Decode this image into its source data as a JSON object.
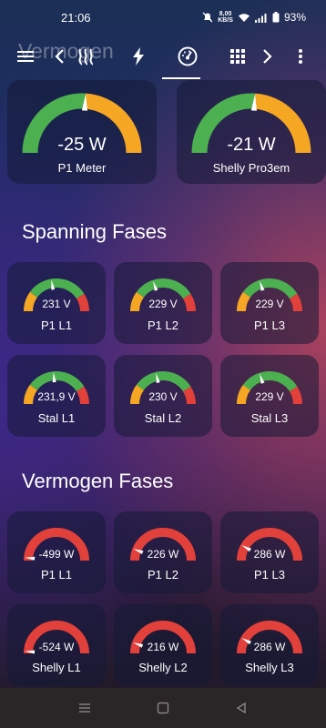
{
  "status": {
    "time": "21:06",
    "net_speed_value": "8,00",
    "net_speed_unit": "KB/S",
    "battery": "93%"
  },
  "toolbar": {
    "ghost_title": "Vermogen"
  },
  "main_gauges": [
    {
      "value": "-25 W",
      "label": "P1 Meter",
      "level": 0.52
    },
    {
      "value": "-21 W",
      "label": "Shelly Pro3em",
      "level": 0.52
    }
  ],
  "sections": {
    "voltage_title": "Spanning Fases",
    "power_title": "Vermogen Fases"
  },
  "voltage_gauges": [
    {
      "value": "231 V",
      "label": "P1 L1",
      "level": 0.45
    },
    {
      "value": "229 V",
      "label": "P1 L2",
      "level": 0.4
    },
    {
      "value": "229 V",
      "label": "P1 L3",
      "level": 0.4
    },
    {
      "value": "231,9 V",
      "label": "Stal L1",
      "level": 0.47
    },
    {
      "value": "230 V",
      "label": "Stal L2",
      "level": 0.43
    },
    {
      "value": "229 V",
      "label": "Stal L3",
      "level": 0.4
    }
  ],
  "power_gauges": [
    {
      "value": "-499 W",
      "label": "P1 L1",
      "level": 0.03
    },
    {
      "value": "226 W",
      "label": "P1 L2",
      "level": 0.12
    },
    {
      "value": "286 W",
      "label": "P1 L3",
      "level": 0.16
    },
    {
      "value": "-524 W",
      "label": "Shelly L1",
      "level": 0.02
    },
    {
      "value": "216 W",
      "label": "Shelly L2",
      "level": 0.11
    },
    {
      "value": "286 W",
      "label": "Shelly L3",
      "level": 0.16
    }
  ],
  "colors": {
    "green": "#4caf50",
    "orange": "#f5a623",
    "red": "#e2403a",
    "needle": "#ffffff"
  }
}
